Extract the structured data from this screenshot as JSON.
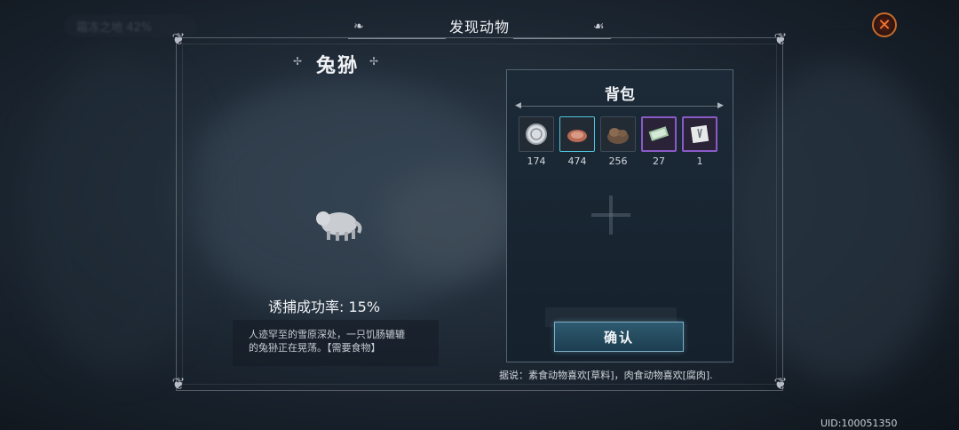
{
  "header": {
    "title": "发现动物",
    "top_left_chip": "霜冻之地 42%"
  },
  "animal": {
    "name": "兔狲",
    "capture_rate": "诱捕成功率: 15%",
    "description_line1": "人迹罕至的雪原深处，一只饥肠辘辘",
    "description_line2": "的兔狲正在晃荡。【需要食物】"
  },
  "backpack": {
    "title": "背包",
    "items": [
      {
        "icon": "coin-icon",
        "count": "174"
      },
      {
        "icon": "raw-meat-icon",
        "count": "474"
      },
      {
        "icon": "fur-pile-icon",
        "count": "256"
      },
      {
        "icon": "banknotes-icon",
        "count": "27"
      },
      {
        "icon": "letter-icon",
        "count": "1"
      }
    ],
    "confirm_label": "确认"
  },
  "hint": "据说：素食动物喜欢[草料]，肉食动物喜欢[腐肉].",
  "uid": "UID:100051350",
  "colors": {
    "accent": "#4fc4dc",
    "rare_border": "#8a5bc7",
    "close": "#c86a2a"
  }
}
